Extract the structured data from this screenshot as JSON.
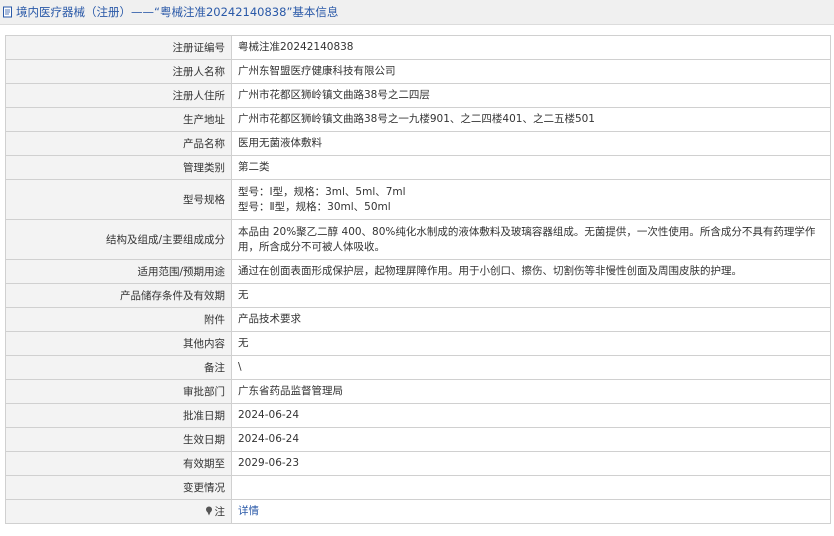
{
  "header": {
    "title": "境内医疗器械（注册）——“粤械注准20242140838”基本信息"
  },
  "rows": [
    {
      "label": "注册证编号",
      "value": "粤械注准20242140838"
    },
    {
      "label": "注册人名称",
      "value": "广州东智盟医疗健康科技有限公司"
    },
    {
      "label": "注册人住所",
      "value": "广州市花都区狮岭镇文曲路38号之二四层"
    },
    {
      "label": "生产地址",
      "value": "广州市花都区狮岭镇文曲路38号之一九楼901、之二四楼401、之二五楼501"
    },
    {
      "label": "产品名称",
      "value": "医用无菌液体敷料"
    },
    {
      "label": "管理类别",
      "value": "第二类"
    },
    {
      "label": "型号规格",
      "lines": [
        "型号：Ⅰ型，规格：3ml、5ml、7ml",
        "型号：Ⅱ型，规格：30ml、50ml"
      ]
    },
    {
      "label": "结构及组成/主要组成成分",
      "value": "本品由 20%聚乙二醇 400、80%纯化水制成的液体敷料及玻璃容器组成。无菌提供，一次性使用。所含成分不具有药理学作用，所含成分不可被人体吸收。"
    },
    {
      "label": "适用范围/预期用途",
      "value": "通过在创面表面形成保护层，起物理屏障作用。用于小创口、擦伤、切割伤等非慢性创面及周围皮肤的护理。"
    },
    {
      "label": "产品储存条件及有效期",
      "value": "无"
    },
    {
      "label": "附件",
      "value": "产品技术要求"
    },
    {
      "label": "其他内容",
      "value": "无"
    },
    {
      "label": "备注",
      "value": "\\"
    },
    {
      "label": "审批部门",
      "value": "广东省药品监督管理局"
    },
    {
      "label": "批准日期",
      "value": "2024-06-24"
    },
    {
      "label": "生效日期",
      "value": "2024-06-24"
    },
    {
      "label": "有效期至",
      "value": "2029-06-23"
    },
    {
      "label": "变更情况",
      "value": ""
    }
  ],
  "note_row": {
    "label": "注",
    "link": "详情"
  }
}
